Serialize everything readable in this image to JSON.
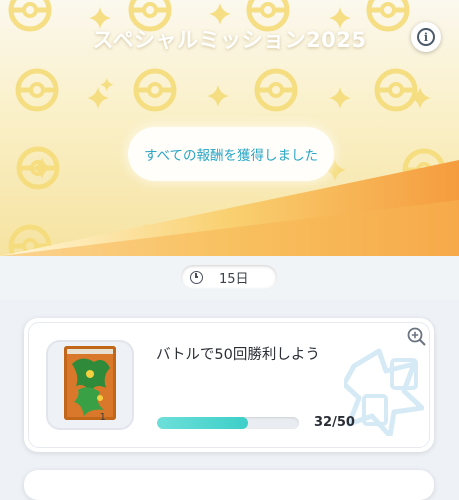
{
  "header": {
    "title": "スペシャルミッション2025",
    "info_icon": "info-icon",
    "info_glyph": "i",
    "status": "すべての報酬を獲得しました"
  },
  "timer": {
    "icon": "clock-icon",
    "remaining": "15日"
  },
  "mission": {
    "title": "バトルで50回勝利しよう",
    "reward_count": "1",
    "progress_text": "32/50",
    "progress_fraction": 0.64,
    "zoom_icon": "zoom-in-icon"
  },
  "colors": {
    "accent": "#2aa6c6",
    "progress_fill": "#3ccfc8",
    "banner_orange": "#f7a84a"
  }
}
